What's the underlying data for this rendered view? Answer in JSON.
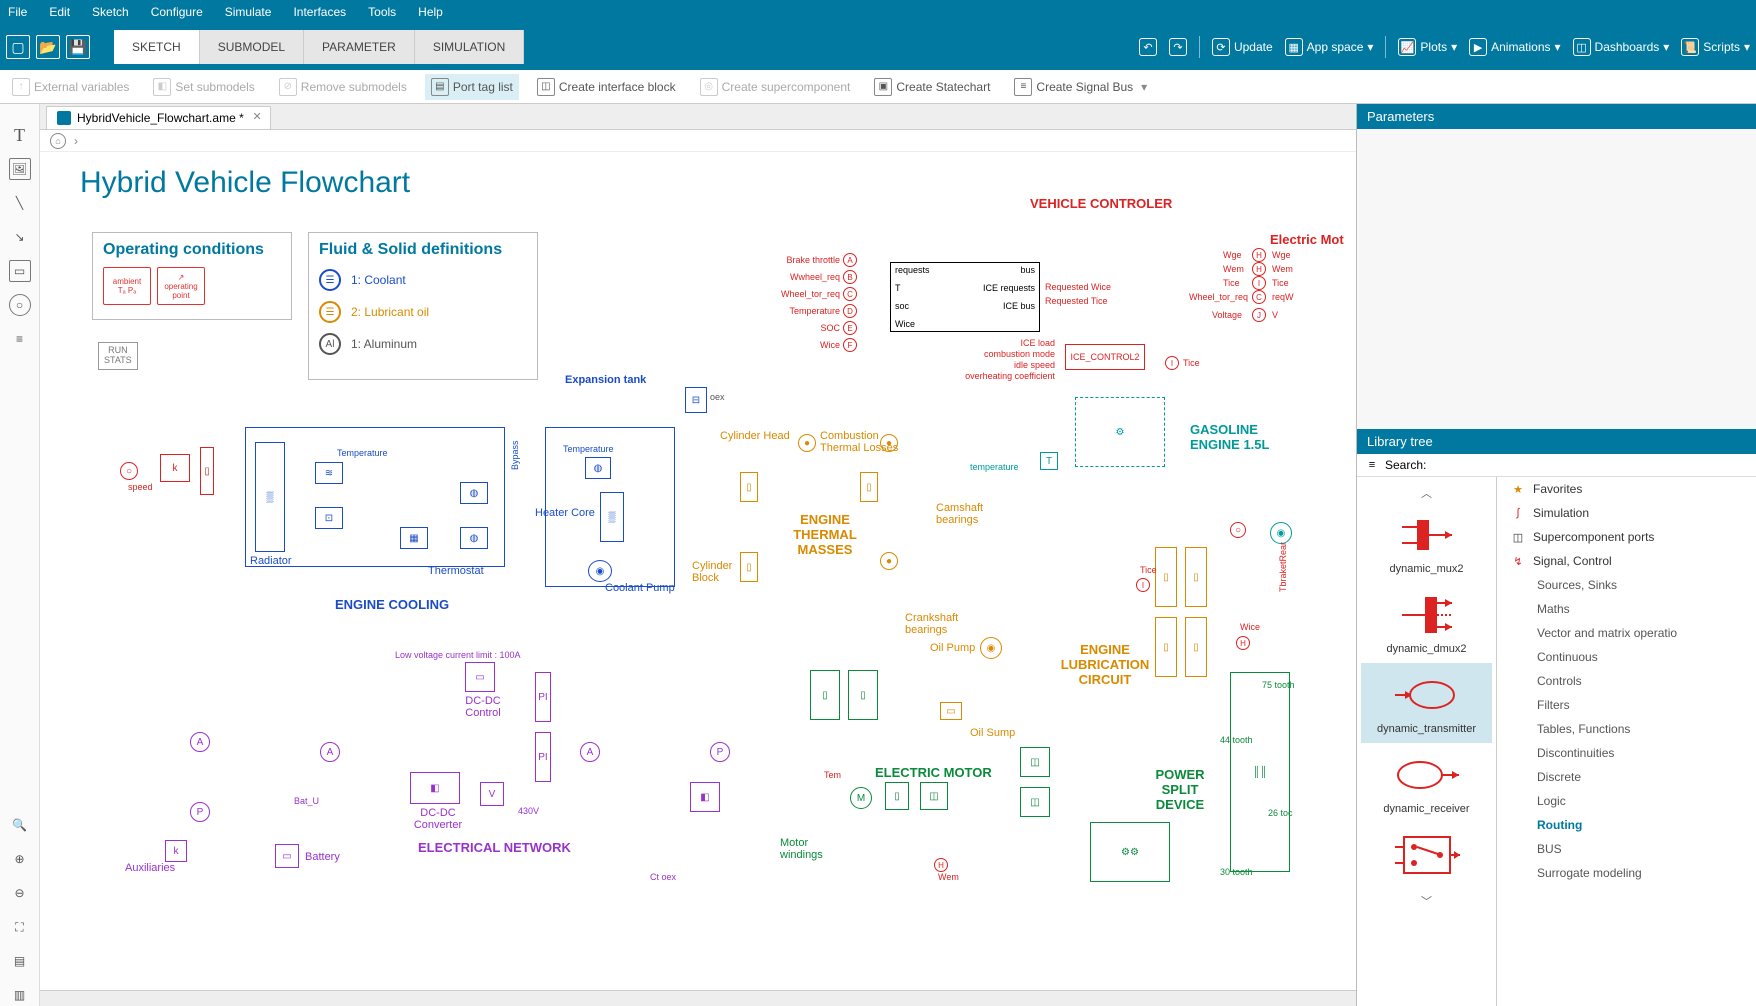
{
  "menu": [
    "File",
    "Edit",
    "Sketch",
    "Configure",
    "Simulate",
    "Interfaces",
    "Tools",
    "Help"
  ],
  "tabs": [
    "SKETCH",
    "SUBMODEL",
    "PARAMETER",
    "SIMULATION"
  ],
  "active_tab": "SKETCH",
  "ribbon_right": {
    "update": "Update",
    "app_space": "App space",
    "plots": "Plots",
    "animations": "Animations",
    "dashboards": "Dashboards",
    "scripts": "Scripts"
  },
  "subbar": {
    "external_vars": "External variables",
    "set_submodels": "Set submodels",
    "remove_submodels": "Remove submodels",
    "port_tag_list": "Port tag list",
    "create_interface_block": "Create interface block",
    "create_supercomponent": "Create supercomponent",
    "create_statechart": "Create Statechart",
    "create_signal_bus": "Create Signal Bus"
  },
  "file_tab": "HybridVehicle_Flowchart.ame *",
  "title": "Hybrid Vehicle Flowchart",
  "operating_conditions": {
    "header": "Operating conditions",
    "ambient": "ambient",
    "ambient_sub": "Tₐ  Pₐ",
    "op_point": "operating point"
  },
  "run_stats": "RUN\nSTATS",
  "fluid_solid": {
    "header": "Fluid & Solid definitions",
    "coolant": "1: Coolant",
    "lubricant": "2: Lubricant oil",
    "aluminum": "1: Aluminum"
  },
  "diagram": {
    "vehicle_controller": "VEHICLE CONTROLER",
    "electric_mot": "Electric Mot",
    "expansion_tank": "Expansion tank",
    "radiator": "Radiator",
    "thermostat": "Thermostat",
    "heater_core": "Heater Core",
    "coolant_pump": "Coolant Pump",
    "engine_cooling": "ENGINE COOLING",
    "temperature": "Temperature",
    "bypass": "Bypass",
    "speed": "speed",
    "cylinder_head": "Cylinder Head",
    "combustion_losses": "Combustion Thermal Losses",
    "engine_thermal_masses": "ENGINE THERMAL MASSES",
    "cylinder_block": "Cylinder Block",
    "crankshaft_bearings": "Crankshaft bearings",
    "camshaft_bearings": "Camshaft bearings",
    "gasoline_engine": "GASOLINE ENGINE 1.5L",
    "oil_pump": "Oil Pump",
    "oil_sump": "Oil Sump",
    "engine_lub": "ENGINE LUBRICATION CIRCUIT",
    "electric_motor": "ELECTRIC MOTOR",
    "motor_windings": "Motor windings",
    "power_split": "POWER SPLIT DEVICE",
    "electrical_network": "ELECTRICAL NETWORK",
    "dcdc_converter": "DC-DC Converter",
    "dcdc_control": "DC-DC Control",
    "battery": "Battery",
    "auxiliaries": "Auxiliaries",
    "low_voltage": "Low voltage current limit : 100A",
    "v430": "430V",
    "bat_u": "Bat_U",
    "tooth75": "75 tooth",
    "tooth44": "44 tooth",
    "tooth26": "26 toc",
    "tooth30": "30 tooth",
    "tb_rear": "TbraketRear",
    "tem": "Tem",
    "wem": "Wem",
    "tice": "Tice",
    "wice": "Wice",
    "ice_control": "ICE_CONTROL2",
    "ice_load": "ICE load",
    "comb_mode": "combustion mode",
    "idle_speed": "idle speed",
    "overheat": "overheating coefficient",
    "brake_throttle": "Brake throttle",
    "wwheel_req": "Wwheel_req",
    "wheel_tor_req": "Wheel_tor_req",
    "temp_sig": "Temperature",
    "soc": "SOC",
    "wice_sig": "Wice",
    "bus_requests": "requests",
    "bus_T": "T",
    "bus_soc": "soc",
    "bus_wice": "Wice",
    "bus_bus": "bus",
    "bus_ice_req": "ICE requests",
    "bus_ice_bus": "ICE bus",
    "req_wice": "Requested Wice",
    "req_tice": "Requested Tice",
    "wge": "Wge",
    "wem_r": "Wem",
    "tice_r": "Tice",
    "voltage": "Voltage",
    "wheel_tor_r": "Wheel_tor_req",
    "wge2": "Wge",
    "wem2": "Wem",
    "tice2": "Tice",
    "reqW": "reqW",
    "v_r": "V",
    "temperature2": "temperature",
    "ct_oex": "Ct oex"
  },
  "right": {
    "parameters": "Parameters",
    "library_tree": "Library tree",
    "search_label": "Search:",
    "search_placeholder": "",
    "thumbs": [
      "dynamic_mux2",
      "dynamic_dmux2",
      "dynamic_transmitter",
      "dynamic_receiver",
      ""
    ],
    "tree": {
      "favorites": "Favorites",
      "simulation": "Simulation",
      "supercomponent": "Supercomponent ports",
      "signal_control": "Signal, Control",
      "sources": "Sources, Sinks",
      "maths": "Maths",
      "vector": "Vector and matrix operatio",
      "continuous": "Continuous",
      "controls": "Controls",
      "filters": "Filters",
      "tables": "Tables, Functions",
      "disc": "Discontinuities",
      "discrete": "Discrete",
      "logic": "Logic",
      "routing": "Routing",
      "bus": "BUS",
      "surrogate": "Surrogate modeling"
    }
  }
}
